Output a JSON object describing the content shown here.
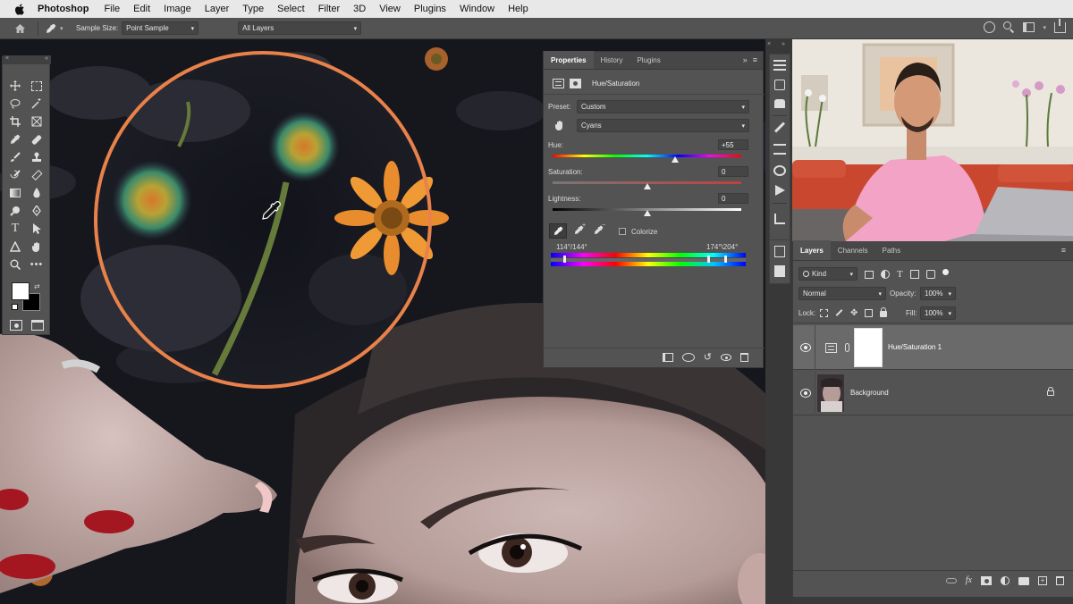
{
  "menubar": {
    "app_name": "Photoshop",
    "items": [
      "File",
      "Edit",
      "Image",
      "Layer",
      "Type",
      "Select",
      "Filter",
      "3D",
      "View",
      "Plugins",
      "Window",
      "Help"
    ]
  },
  "options_bar": {
    "sample_size_label": "Sample Size:",
    "sample_size_value": "Point Sample",
    "sample_layers_value": "All Layers"
  },
  "properties": {
    "tabs": [
      "Properties",
      "History",
      "Plugins"
    ],
    "adjustment_title": "Hue/Saturation",
    "preset_label": "Preset:",
    "preset_value": "Custom",
    "channel_value": "Cyans",
    "hue_label": "Hue:",
    "hue_value": "+55",
    "hue_level": 0.65,
    "saturation_label": "Saturation:",
    "saturation_value": "0",
    "saturation_level": 0.5,
    "lightness_label": "Lightness:",
    "lightness_value": "0",
    "lightness_level": 0.5,
    "colorize_label": "Colorize",
    "range_left": "114°/144°",
    "range_right": "174°\\204°"
  },
  "layers_panel": {
    "tabs": [
      "Layers",
      "Channels",
      "Paths"
    ],
    "filter_value": "Kind",
    "blend_mode": "Normal",
    "opacity_label": "Opacity:",
    "opacity_value": "100%",
    "lock_label": "Lock:",
    "fill_label": "Fill:",
    "fill_value": "100%",
    "layers": [
      {
        "name": "Hue/Saturation 1",
        "selected": true
      },
      {
        "name": "Background",
        "selected": false
      }
    ]
  },
  "colors": {
    "accent_ring": "#e9824a",
    "panel_bg": "#535353",
    "selected_layer": "#6a6a6a"
  }
}
